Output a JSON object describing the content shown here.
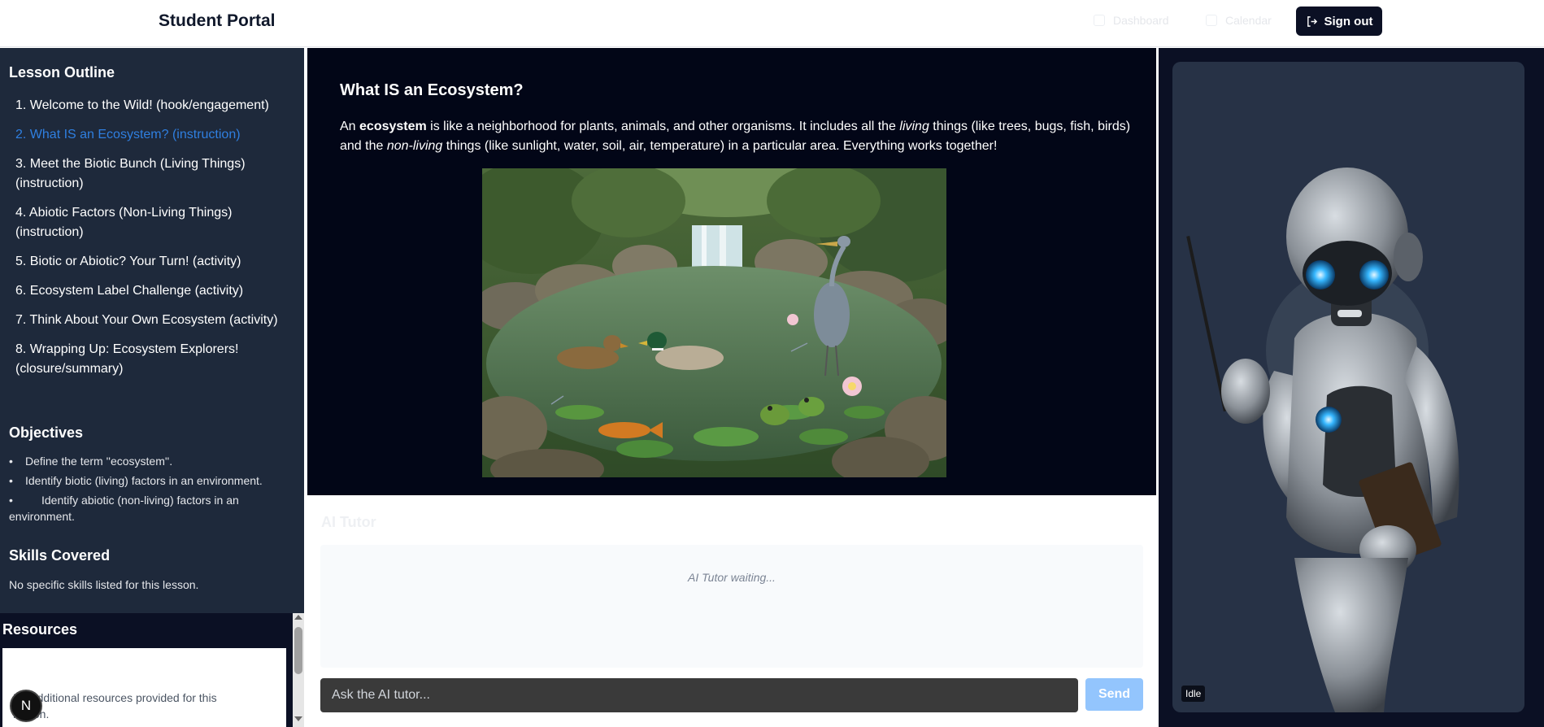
{
  "header": {
    "brand": "Student Portal",
    "nav": [
      {
        "label": "Dashboard",
        "icon": "home-icon"
      },
      {
        "label": "Calendar",
        "icon": "calendar-icon"
      }
    ],
    "signout_label": "Sign out"
  },
  "sidebar": {
    "outline_title": "Lesson Outline",
    "outline": [
      "1. Welcome to the Wild! (hook/engagement)",
      "2. What IS an Ecosystem? (instruction)",
      "3. Meet the Biotic Bunch (Living Things) (instruction)",
      "4. Abiotic Factors (Non-Living Things) (instruction)",
      "5. Biotic or Abiotic? Your Turn! (activity)",
      "6. Ecosystem Label Challenge (activity)",
      "7. Think About Your Own Ecosystem (activity)",
      "8. Wrapping Up: Ecosystem Explorers! (closure/summary)"
    ],
    "active_index": 1,
    "objectives_title": "Objectives",
    "objectives": [
      "Define the term ''ecosystem''.",
      "Identify biotic (living) factors in an environment.",
      "Identify abiotic (non-living) factors in an environment."
    ],
    "skills_title": "Skills Covered",
    "skills_text": "No specific skills listed for this lesson."
  },
  "resources": {
    "title": "Resources",
    "text": "No additional resources provided for this lesson.",
    "badge": "N"
  },
  "lesson": {
    "title": "What IS an Ecosystem?",
    "para": {
      "p1": "An ",
      "b1": "ecosystem",
      "p2": " is like a neighborhood for plants, animals, and other organisms. It includes all the ",
      "i1": "living",
      "p3": " things (like trees, bugs, fish, birds) and the ",
      "i2": "non-living",
      "p4": " things (like sunlight, water, soil, air, temperature) in a particular area. Everything works together!"
    }
  },
  "tutor": {
    "title": "AI Tutor",
    "waiting": "AI Tutor waiting...",
    "input_placeholder": "Ask the AI tutor...",
    "send_label": "Send"
  },
  "robot": {
    "status": "Idle"
  },
  "colors": {
    "active_link": "#2f7fe0",
    "sidebar_bg": "#1e293b",
    "lesson_bg": "#020617",
    "send_button": "#93c5fd",
    "robot_eye": "#36b7ff"
  }
}
